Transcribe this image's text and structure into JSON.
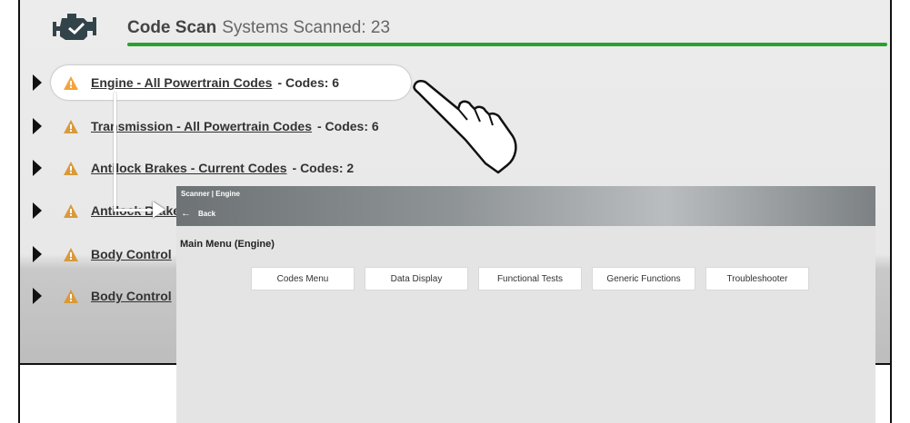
{
  "header": {
    "title": "Code Scan",
    "subtitle": "Systems Scanned: 23",
    "progress": 1.0
  },
  "systems": [
    {
      "name": "Engine - All Powertrain Codes",
      "codes": "Codes: 6"
    },
    {
      "name": "Transmission - All Powertrain Codes",
      "codes": "Codes: 6"
    },
    {
      "name": "Antilock Brakes - Current Codes",
      "codes": "Codes: 2"
    },
    {
      "name": "Antilock Brakes",
      "codes": ""
    },
    {
      "name": "Body Control",
      "codes": ""
    },
    {
      "name": "Body Control",
      "codes": ""
    }
  ],
  "engine_panel": {
    "breadcrumb": "Scanner | Engine",
    "back_label": "Back",
    "menu_title": "Main Menu (Engine)",
    "buttons": [
      "Codes Menu",
      "Data Display",
      "Functional Tests",
      "Generic Functions",
      "Troubleshooter"
    ]
  },
  "colors": {
    "progress": "#2aa12f",
    "warning": "#f2a43a"
  }
}
